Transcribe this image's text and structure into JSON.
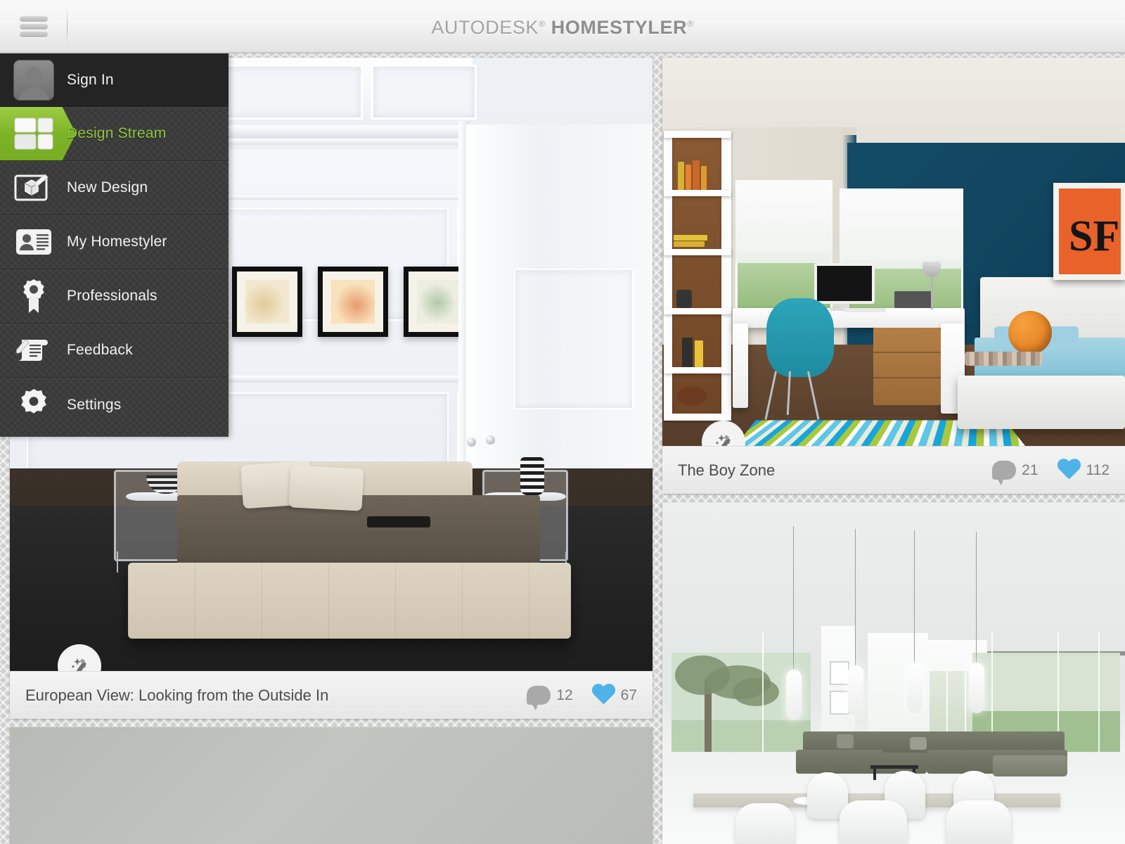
{
  "header": {
    "brand_light": "AUTODESK",
    "brand_bold": "HOMESTYLER",
    "reg_mark": "®",
    "menu_icon": "hamburger-icon"
  },
  "sidebar": {
    "items": [
      {
        "id": "sign-in",
        "label": "Sign In",
        "icon": "user-avatar-icon",
        "active": false
      },
      {
        "id": "design-stream",
        "label": "Design Stream",
        "icon": "grid-layout-icon",
        "active": true
      },
      {
        "id": "new-design",
        "label": "New Design",
        "icon": "cube-pencil-icon",
        "active": false
      },
      {
        "id": "my-homestyler",
        "label": "My Homestyler",
        "icon": "id-card-icon",
        "active": false
      },
      {
        "id": "professionals",
        "label": "Professionals",
        "icon": "award-ribbon-icon",
        "active": false
      },
      {
        "id": "feedback",
        "label": "Feedback",
        "icon": "pencil-paper-icon",
        "active": false
      },
      {
        "id": "settings",
        "label": "Settings",
        "icon": "gear-icon",
        "active": false
      }
    ],
    "active_color": "#8ec63f",
    "background_color": "#3c3c3c"
  },
  "stream": {
    "cards": [
      {
        "id": "european-view",
        "title": "European View: Looking from the Outside In",
        "comments": "12",
        "likes": "67",
        "badge_icon": "magic-wand-icon",
        "scene": "european-bedroom"
      },
      {
        "id": "the-boy-zone",
        "title": "The Boy Zone",
        "comments": "21",
        "likes": "112",
        "badge_icon": "magic-wand-icon",
        "scene": "boy-bedroom"
      },
      {
        "id": "modern-dining",
        "title": "",
        "comments": "",
        "likes": "",
        "badge_icon": "",
        "scene": "modern-dining"
      },
      {
        "id": "loading-placeholder",
        "title": "",
        "comments": "",
        "likes": "",
        "badge_icon": "",
        "scene": "placeholder"
      }
    ],
    "comment_icon": "speech-bubble-icon",
    "like_icon": "heart-icon",
    "like_color": "#4eb3e8",
    "comment_color": "#a9a9a9"
  }
}
